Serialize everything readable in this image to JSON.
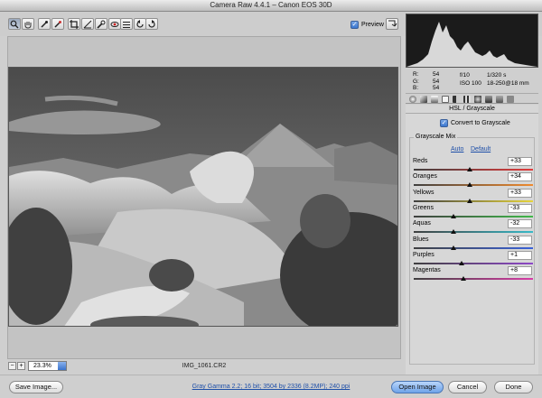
{
  "window": {
    "title": "Camera Raw 4.4.1  –  Canon EOS 30D"
  },
  "toolbar": {
    "tools": [
      "zoom-icon",
      "hand-icon",
      "white-balance-icon",
      "color-sampler-icon",
      "crop-icon",
      "straighten-icon",
      "retouch-icon",
      "red-eye-icon",
      "preferences-icon",
      "rotate-left-icon",
      "rotate-right-icon"
    ],
    "preview_label": "Preview",
    "preview_checked": true
  },
  "readout": {
    "r_label": "R:",
    "r_value": "54",
    "g_label": "G:",
    "g_value": "54",
    "b_label": "B:",
    "b_value": "54",
    "aperture": "f/10",
    "shutter": "1/320 s",
    "iso": "ISO 100",
    "lens": "18-250@18 mm"
  },
  "panel": {
    "title": "HSL / Grayscale",
    "convert_label": "Convert to Grayscale",
    "convert_checked": true,
    "mix_label": "Grayscale Mix",
    "auto_label": "Auto",
    "default_label": "Default",
    "sliders": [
      {
        "label": "Reds",
        "value": "+33",
        "pos": 33,
        "track": "linear-gradient(90deg,#3f3f3f,#e23c3c)"
      },
      {
        "label": "Oranges",
        "value": "+34",
        "pos": 34,
        "track": "linear-gradient(90deg,#3f3f3f,#ee8a2f)"
      },
      {
        "label": "Yellows",
        "value": "+33",
        "pos": 33,
        "track": "linear-gradient(90deg,#3f3f3f,#e6d43a)"
      },
      {
        "label": "Greens",
        "value": "-33",
        "pos": -33,
        "track": "linear-gradient(90deg,#3f3f3f,#41b84a)"
      },
      {
        "label": "Aquas",
        "value": "-32",
        "pos": -32,
        "track": "linear-gradient(90deg,#3f3f3f,#37b9c7)"
      },
      {
        "label": "Blues",
        "value": "-33",
        "pos": -33,
        "track": "linear-gradient(90deg,#3f3f3f,#3b62d8)"
      },
      {
        "label": "Purples",
        "value": "+1",
        "pos": 1,
        "track": "linear-gradient(90deg,#3f3f3f,#8e48c8)"
      },
      {
        "label": "Magentas",
        "value": "+8",
        "pos": 8,
        "track": "linear-gradient(90deg,#3f3f3f,#d83ca6)"
      }
    ]
  },
  "status": {
    "zoom_value": "23.3%",
    "filename": "IMG_1061.CR2"
  },
  "bottom": {
    "save_label": "Save Image...",
    "workflow_label": "Gray Gamma 2.2; 16 bit; 3504 by 2336 (8.2MP); 240 ppi",
    "open_label": "Open Image",
    "cancel_label": "Cancel",
    "done_label": "Done"
  }
}
